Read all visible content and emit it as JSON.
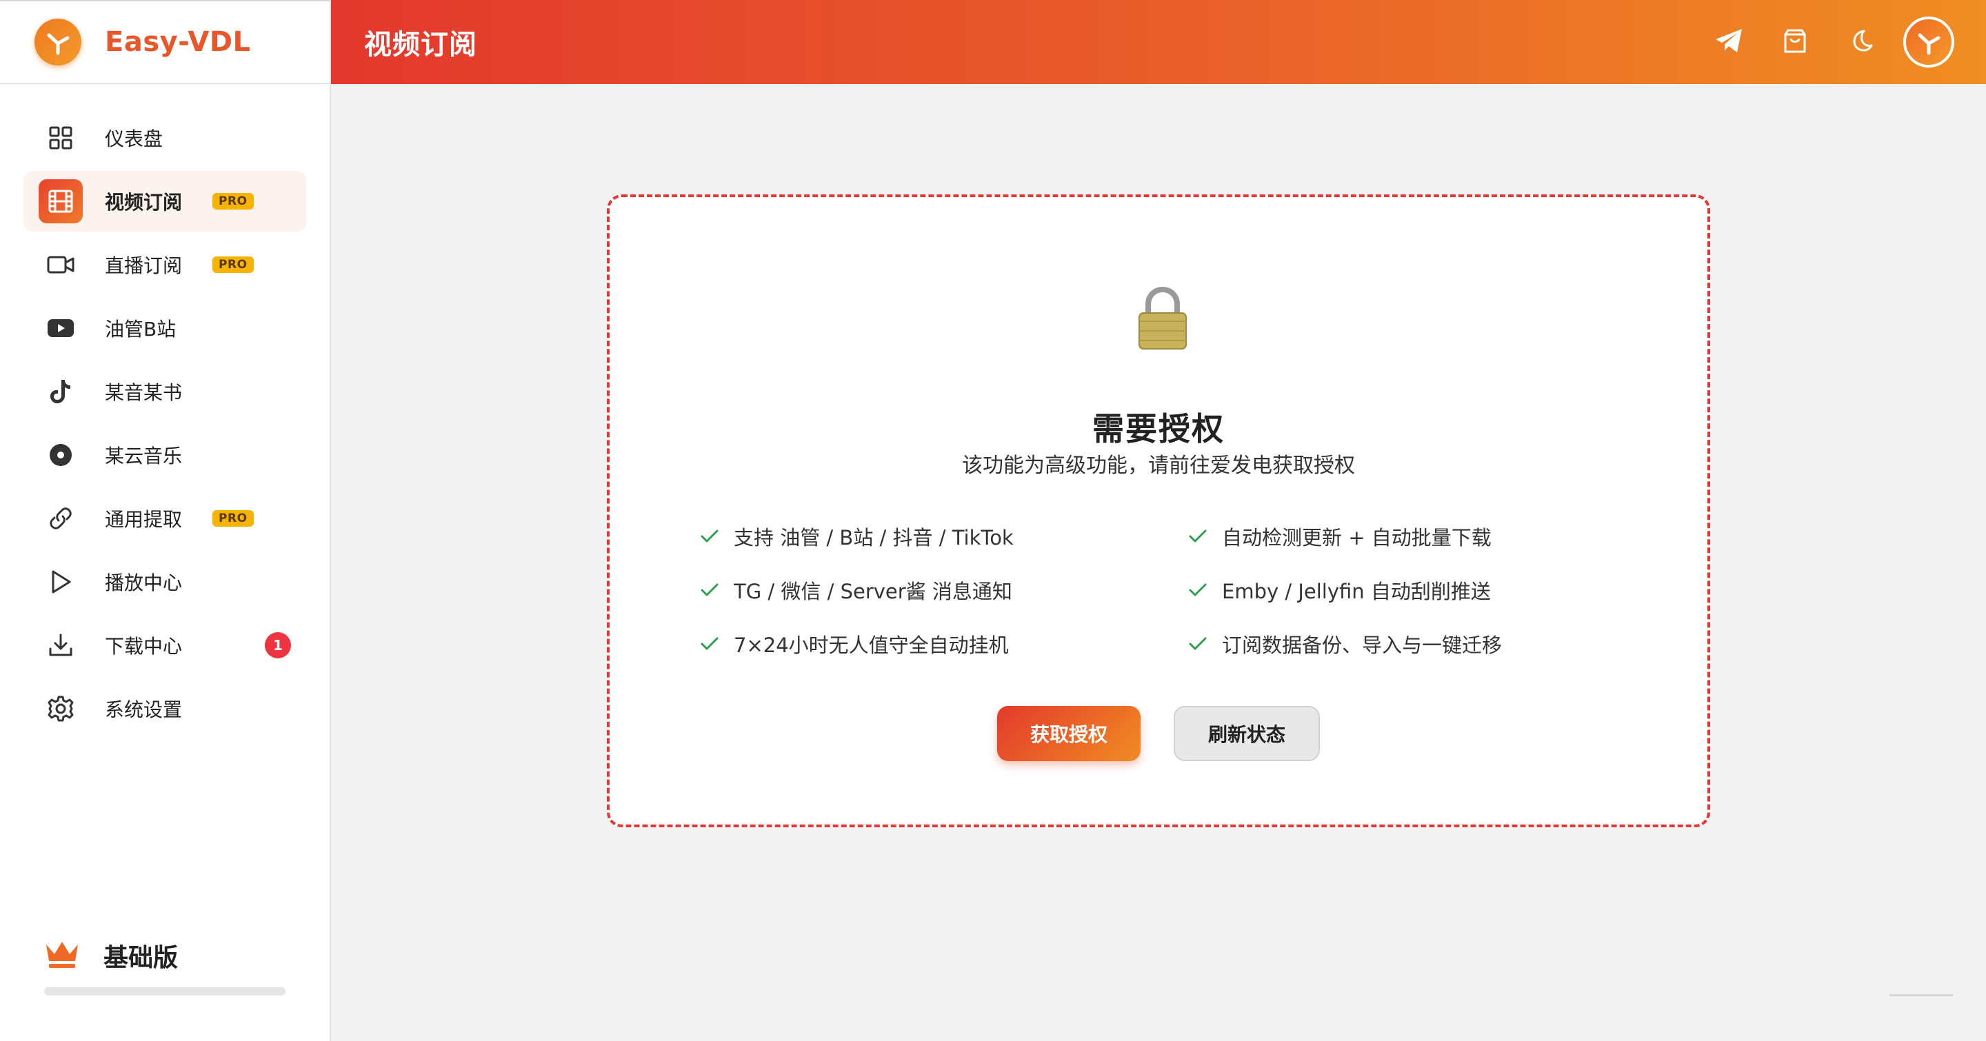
{
  "app": {
    "name": "Easy-VDL",
    "page_title": "视频订阅"
  },
  "colors": {
    "accent": "#e8572a",
    "header_gradient": [
      "#e3382d",
      "#f08e22"
    ],
    "pro_badge": "#f6b400",
    "count_badge": "#f03340",
    "card_border": "#e53535",
    "check": "#2e9e4f"
  },
  "sidebar": {
    "items": [
      {
        "label": "仪表盘",
        "icon": "dashboard-grid-icon",
        "active": false
      },
      {
        "label": "视频订阅",
        "icon": "film-icon",
        "active": true,
        "badge": "PRO"
      },
      {
        "label": "直播订阅",
        "icon": "video-camera-icon",
        "active": false,
        "badge": "PRO"
      },
      {
        "label": "油管B站",
        "icon": "youtube-icon",
        "active": false
      },
      {
        "label": "某音某书",
        "icon": "tiktok-icon",
        "active": false
      },
      {
        "label": "某云音乐",
        "icon": "music-disc-icon",
        "active": false
      },
      {
        "label": "通用提取",
        "icon": "link-icon",
        "active": false,
        "badge": "PRO"
      },
      {
        "label": "播放中心",
        "icon": "play-icon",
        "active": false
      },
      {
        "label": "下载中心",
        "icon": "download-icon",
        "active": false,
        "count": "1"
      },
      {
        "label": "系统设置",
        "icon": "gear-icon",
        "active": false
      }
    ],
    "plan": {
      "label": "基础版",
      "icon": "crown-icon"
    }
  },
  "header": {
    "actions": [
      "telegram-icon",
      "shopping-bag-icon",
      "moon-icon",
      "avatar"
    ]
  },
  "license_card": {
    "icon": "lock-icon",
    "title": "需要授权",
    "subtitle": "该功能为高级功能，请前往爱发电获取授权",
    "features": [
      "支持 油管 / B站 / 抖音 / TikTok",
      "自动检测更新 + 自动批量下载",
      "TG / 微信 / Server酱 消息通知",
      "Emby / Jellyfin 自动刮削推送",
      "7×24小时无人值守全自动挂机",
      "订阅数据备份、导入与一键迁移"
    ],
    "primary_button": "获取授权",
    "secondary_button": "刷新状态"
  }
}
